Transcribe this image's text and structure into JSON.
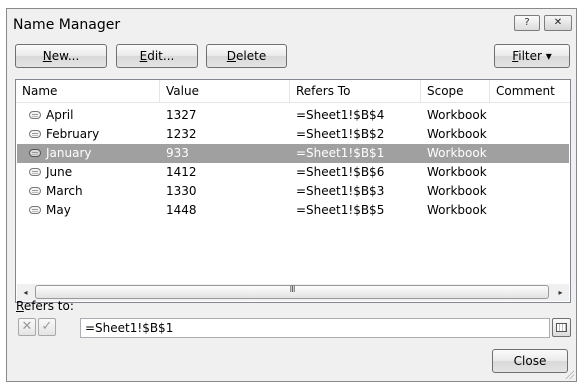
{
  "window": {
    "title": "Name Manager",
    "help_glyph": "?",
    "close_glyph": "✕"
  },
  "toolbar": {
    "new": {
      "mnemonic": "N",
      "rest": "ew..."
    },
    "edit": {
      "mnemonic": "E",
      "rest": "dit..."
    },
    "delete": {
      "mnemonic": "D",
      "rest": "elete"
    },
    "filter": {
      "mnemonic": "F",
      "rest": "ilter",
      "arrow": "▾"
    }
  },
  "table": {
    "columns": [
      "Name",
      "Value",
      "Refers To",
      "Scope",
      "Comment"
    ],
    "rows": [
      {
        "name": "April",
        "value": "1327",
        "refers_to": "=Sheet1!$B$4",
        "scope": "Workbook",
        "comment": ""
      },
      {
        "name": "February",
        "value": "1232",
        "refers_to": "=Sheet1!$B$2",
        "scope": "Workbook",
        "comment": ""
      },
      {
        "name": "January",
        "value": "933",
        "refers_to": "=Sheet1!$B$1",
        "scope": "Workbook",
        "comment": "",
        "selected": true
      },
      {
        "name": "June",
        "value": "1412",
        "refers_to": "=Sheet1!$B$6",
        "scope": "Workbook",
        "comment": ""
      },
      {
        "name": "March",
        "value": "1330",
        "refers_to": "=Sheet1!$B$3",
        "scope": "Workbook",
        "comment": ""
      },
      {
        "name": "May",
        "value": "1448",
        "refers_to": "=Sheet1!$B$5",
        "scope": "Workbook",
        "comment": ""
      }
    ],
    "scrollbar": {
      "left_arrow": "◂",
      "right_arrow": "▸",
      "thumb_grip": "III"
    }
  },
  "refers_to": {
    "label_mnemonic": "R",
    "label_rest": "efers to:",
    "value": "=Sheet1!$B$1",
    "cancel_glyph": "✕",
    "confirm_glyph": "✓"
  },
  "footer": {
    "close_label": "Close"
  },
  "colors": {
    "selection": "#a0a0a0",
    "window_bg": "#f0f0f0"
  }
}
